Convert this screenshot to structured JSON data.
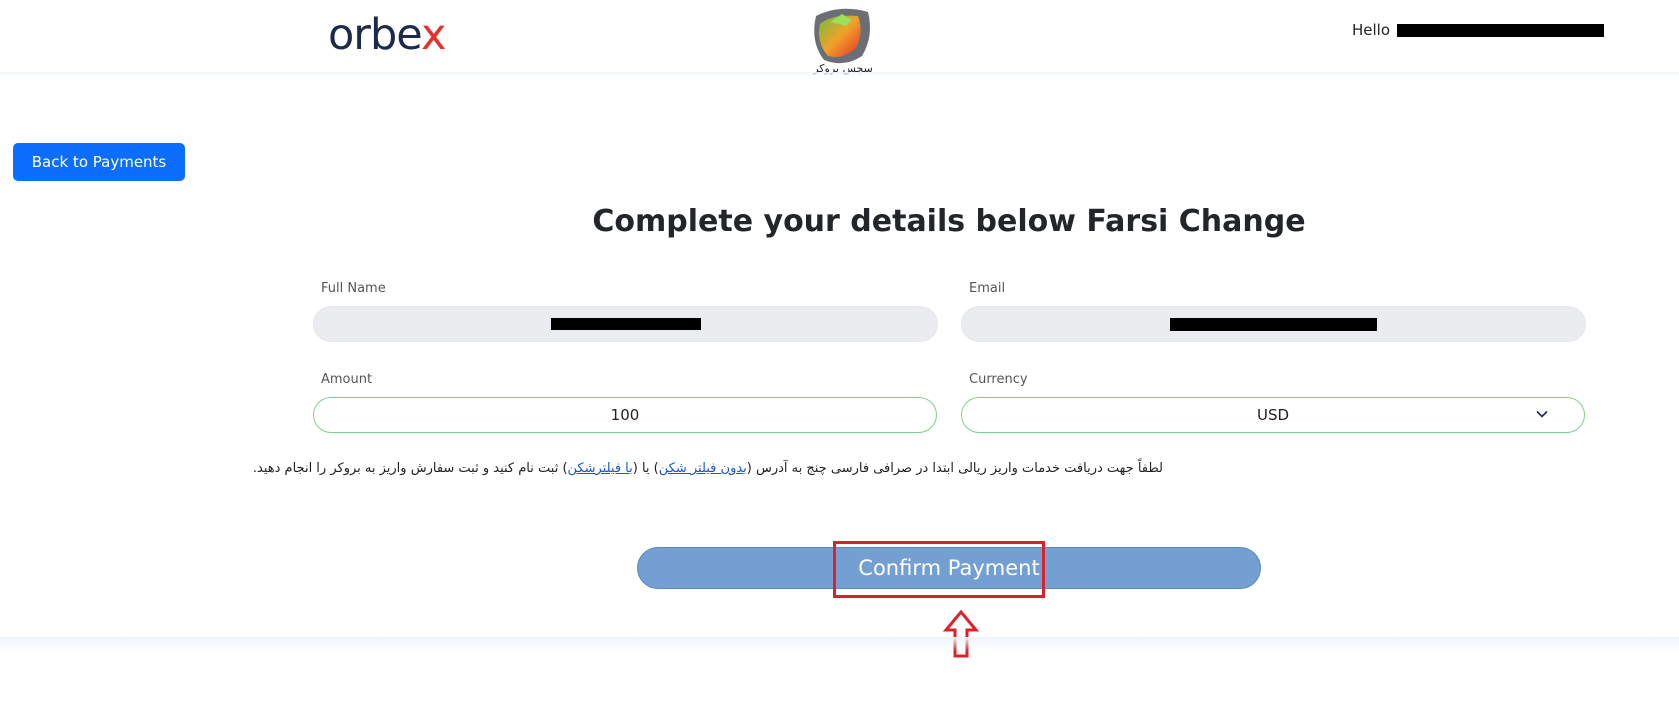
{
  "header": {
    "logo_text": "orbe",
    "logo_accent": "x",
    "partner_caption": "سچس بروکر",
    "greeting": "Hello"
  },
  "navigation": {
    "back_label": "Back to Payments"
  },
  "form": {
    "title": "Complete your details below Farsi Change",
    "full_name_label": "Full Name",
    "email_label": "Email",
    "amount_label": "Amount",
    "amount_value": "100",
    "currency_label": "Currency",
    "currency_value": "USD"
  },
  "note": {
    "prefix": "لطفاً جهت دریافت خدمات واریز ریالی ابتدا در صرافی فارسی چنج به آدرس (",
    "link1": "بدون فیلتر شکن",
    "middle": ") یا (",
    "link2": "با فیلترشکن",
    "suffix": ") ثبت نام کنید و ثبت سفارش واریز به بروکر را انجام دهید."
  },
  "actions": {
    "confirm_label": "Confirm Payment"
  },
  "colors": {
    "primary": "#0d6efd",
    "confirm": "#739fd2",
    "highlight": "#d9222a",
    "valid_border": "#7ed08f",
    "brand_red": "#e4312b",
    "brand_navy": "#1c2a4e"
  },
  "icons": {
    "currency_dropdown": "chevron-down-icon",
    "annotation": "up-arrow-icon"
  }
}
